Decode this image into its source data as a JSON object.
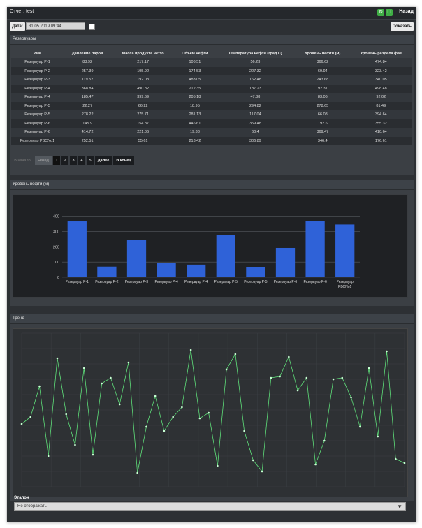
{
  "header": {
    "title": "Отчет: test",
    "back_label": "Назад"
  },
  "filter": {
    "date_label": "Дата:",
    "date_value": "31.05.2019 09:44",
    "show_label": "Показать"
  },
  "tanks_section": {
    "title": "Резервуары",
    "columns": [
      "Имя",
      "Давление паров",
      "Масса продукта нетто",
      "Объем нефти",
      "Температура нефти (град.С)",
      "Уровень нефти (м)",
      "Уровень раздела фаз"
    ],
    "rows": [
      [
        "Резервуар Р-1",
        "83.92",
        "217.17",
        "106.51",
        "56.23",
        "366.62",
        "474.84"
      ],
      [
        "Резервуар Р-2",
        "257.39",
        "195.92",
        "174.53",
        "227.32",
        "69.94",
        "323.42"
      ],
      [
        "Резервуар Р-3",
        "119.52",
        "192.08",
        "483.05",
        "162.48",
        "243.68",
        "340.05"
      ],
      [
        "Резервуар Р-4",
        "368.84",
        "490.82",
        "212.35",
        "187.23",
        "92.31",
        "498.48"
      ],
      [
        "Резервуар Р-4",
        "185.47",
        "399.69",
        "205.18",
        "47.88",
        "83.06",
        "92.02"
      ],
      [
        "Резервуар Р-5",
        "22.27",
        "66.22",
        "18.95",
        "294.82",
        "278.65",
        "81.49"
      ],
      [
        "Резервуар Р-5",
        "278.22",
        "275.71",
        "281.13",
        "117.04",
        "66.08",
        "394.64"
      ],
      [
        "Резервуар Р-6",
        "145.9",
        "154.87",
        "446.61",
        "359.48",
        "192.6",
        "355.32"
      ],
      [
        "Резервуар Р-6",
        "414.72",
        "221.06",
        "19.38",
        "60.4",
        "369.47",
        "410.64"
      ],
      [
        "Резервуар РВСNo1",
        "252.51",
        "55.61",
        "213.42",
        "306.89",
        "346.4",
        "176.61"
      ]
    ]
  },
  "pager": {
    "first": "В начало",
    "prev": "Назад",
    "pages": [
      "1",
      "2",
      "3",
      "4",
      "5"
    ],
    "next": "Далее",
    "last": "В конец"
  },
  "level_section": {
    "title": "Уровень нефти (м)"
  },
  "trend_section": {
    "title": "Тренд"
  },
  "etalon": {
    "label": "Эталон",
    "selected": "Не отображать"
  },
  "chart_data": [
    {
      "type": "bar",
      "categories": [
        "Резервуар Р-1",
        "Резервуар Р-2",
        "Резервуар Р-3",
        "Резервуар Р-4",
        "Резервуар Р-4",
        "Резервуар Р-5",
        "Резервуар Р-5",
        "Резервуар Р-6",
        "Резервуар Р-6",
        "Резервуар РВСNo1"
      ],
      "values": [
        366.62,
        69.94,
        243.68,
        92.31,
        83.06,
        278.65,
        66.08,
        192.6,
        369.47,
        346.4
      ],
      "yticks": [
        0,
        100,
        200,
        300,
        400
      ],
      "ylim": [
        0,
        440
      ],
      "color": "#2f62d8",
      "grid": true
    },
    {
      "type": "line",
      "values": [
        0.45,
        0.5,
        0.72,
        0.22,
        0.92,
        0.52,
        0.3,
        0.85,
        0.23,
        0.74,
        0.78,
        0.59,
        0.89,
        0.1,
        0.43,
        0.65,
        0.4,
        0.5,
        0.57,
        0.98,
        0.49,
        0.53,
        0.15,
        0.84,
        0.95,
        0.4,
        0.19,
        0.11,
        0.78,
        0.79,
        0.93,
        0.69,
        0.78,
        0.16,
        0.33,
        0.77,
        0.78,
        0.64,
        0.43,
        0.85,
        0.36,
        0.97,
        0.2,
        0.17
      ],
      "ylim": [
        0,
        1.1
      ],
      "color": "#5fe07a",
      "grid": true
    }
  ]
}
